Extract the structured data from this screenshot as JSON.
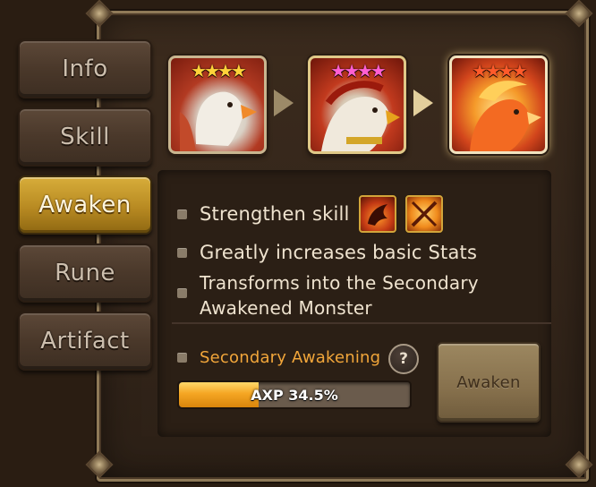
{
  "tabs": [
    {
      "label": "Info",
      "active": false
    },
    {
      "label": "Skill",
      "active": false
    },
    {
      "label": "Awaken",
      "active": true
    },
    {
      "label": "Rune",
      "active": false
    },
    {
      "label": "Artifact",
      "active": false
    }
  ],
  "evolution": [
    {
      "stars": "★★★★",
      "star_color": "#ffd23a",
      "stage": "base"
    },
    {
      "stars": "★★★★",
      "star_color": "#ff5fd2",
      "stage": "awakened"
    },
    {
      "stars": "★★★★",
      "star_color": "#ff5a2a",
      "stage": "secondary-awakened"
    }
  ],
  "benefits": {
    "strengthen_skill": "Strengthen skill",
    "greatly_increases": "Greatly increases basic Stats",
    "transforms_line1": "Transforms into the Secondary",
    "transforms_line2": "Awakened Monster"
  },
  "secondary": {
    "label": "Secondary Awakening",
    "label_color": "#f2a63a",
    "help": "?"
  },
  "axp": {
    "text": "AXP 34.5%",
    "fraction": 0.345
  },
  "awaken_button": "Awaken",
  "colors": {
    "active_tab": "#d7ad3a",
    "bar_fill": "#f5a623"
  }
}
